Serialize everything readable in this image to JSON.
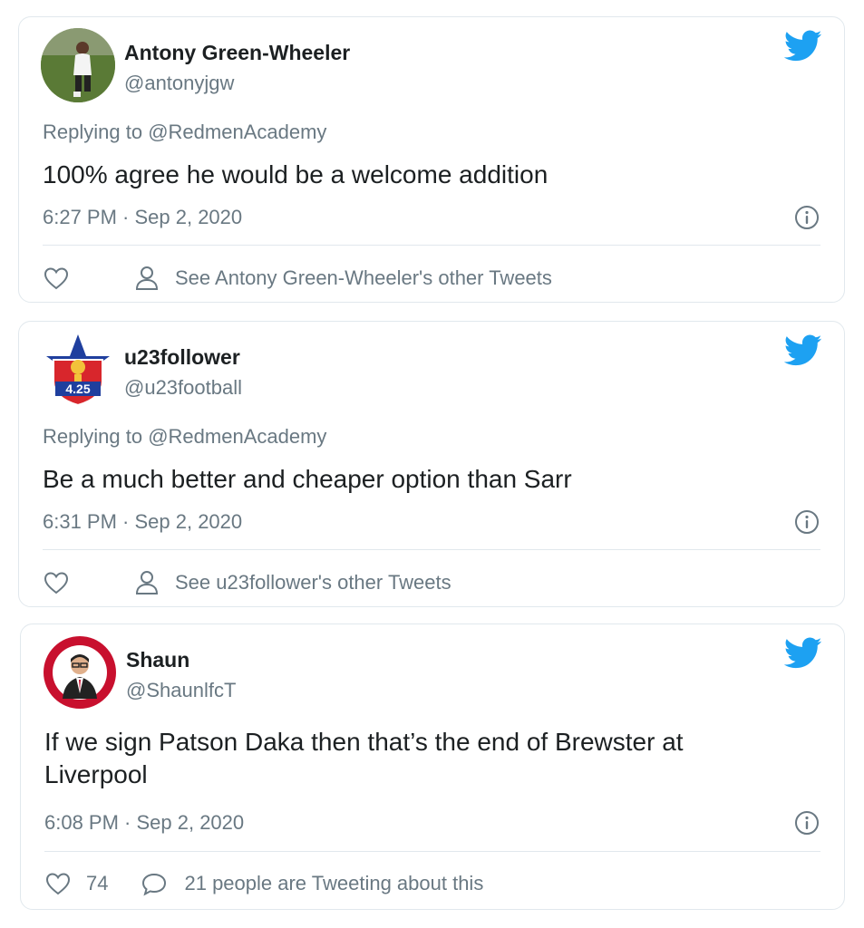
{
  "tweets": [
    {
      "name": "Antony Green-Wheeler",
      "handle": "@antonyjgw",
      "replying_prefix": "Replying to",
      "replying_to": "@RedmenAcademy",
      "text": "100% agree he would be a welcome addition",
      "timestamp": "6:27 PM · Sep 2, 2020",
      "action_text": "See Antony Green-Wheeler's other Tweets",
      "icons": [
        "twitter-bird-icon",
        "info-icon",
        "heart-icon",
        "person-icon"
      ]
    },
    {
      "name": "u23follower",
      "handle": "@u23football",
      "replying_prefix": "Replying to",
      "replying_to": "@RedmenAcademy",
      "text": "Be a much better and cheaper option than Sarr",
      "timestamp": "6:31 PM · Sep 2, 2020",
      "action_text": "See u23follower's other Tweets",
      "avatar_badge": "4.25",
      "icons": [
        "twitter-bird-icon",
        "info-icon",
        "heart-icon",
        "person-icon"
      ]
    },
    {
      "name": "Shaun",
      "handle": "@ShaunlfcT",
      "text": "If we sign Patson Daka then that’s the end of Brewster at Liverpool",
      "timestamp": "6:08 PM · Sep 2, 2020",
      "like_count": "74",
      "action_text": "21 people are Tweeting about this",
      "icons": [
        "twitter-bird-icon",
        "info-icon",
        "heart-icon",
        "comment-icon"
      ]
    }
  ],
  "colors": {
    "twitter_blue": "#1da1f2",
    "text_primary": "#1c2022",
    "text_secondary": "#697882",
    "border": "#e1e8ed"
  }
}
